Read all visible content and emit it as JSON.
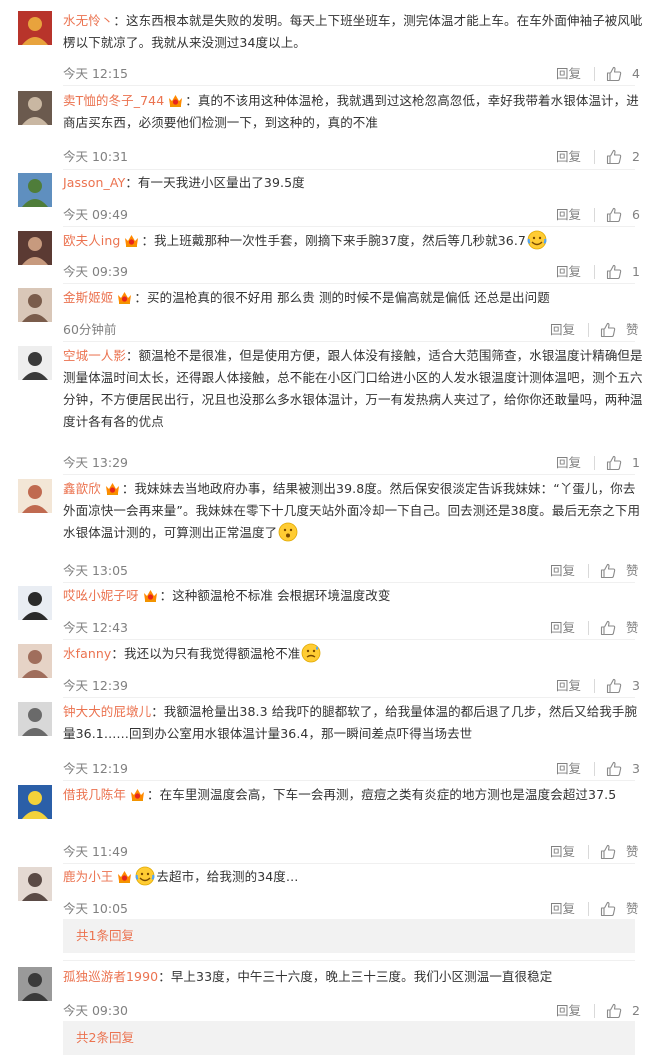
{
  "ui": {
    "reply_label": "回复",
    "like_label": "赞",
    "like_icon": "thumbs-up-icon",
    "badge_icon": "vip-crown-badge-icon"
  },
  "comments": [
    {
      "user": "水无怜丶",
      "text": "：这东西根本就是失败的发明。每天上下班坐班车，测完体温才能上车。在车外面伸袖子被风呲楞以下就凉了。我就从来没测过34度以上。",
      "time": "今天 12:15",
      "likes": "4"
    },
    {
      "user": "卖T恤的冬子_744",
      "text": "：真的不该用这种体温枪，我就遇到过这枪忽高忽低，幸好我带着水银体温计，进商店买东西，必须要他们检测一下，到这种的，真的不准",
      "time": "今天 10:31",
      "likes": "2"
    },
    {
      "user": "Jasson_AY",
      "text": "：有一天我进小区量出了39.5度",
      "time": "今天 09:49",
      "likes": "6"
    },
    {
      "user": "欧夫人ing",
      "text": "：我上班戴那种一次性手套，刚摘下来手腕37度，然后等几秒就36.7",
      "time": "今天 09:39",
      "likes": "1",
      "emoji": "laughing-tears-emoji"
    },
    {
      "user": "金斯姬姬",
      "text": "：买的温枪真的很不好用 那么贵 测的时候不是偏高就是偏低 还总是出问题",
      "time": "60分钟前",
      "likes": "赞"
    },
    {
      "user": "空城一人影",
      "text": "：额温枪不是很准，但是使用方便，跟人体没有接触，适合大范围筛查，水银温度计精确但是测量体温时间太长，还得跟人体接触，总不能在小区门口给进小区的人发水银温度计测体温吧，测个五六分钟，不方便居民出行，况且也没那么多水银体温计，万一有发热病人夹过了，给你你还敢量吗，两种温度计各有各的优点",
      "time": "今天 13:29",
      "likes": "1"
    },
    {
      "user": "鑫歆欣",
      "text": "：我妹妹去当地政府办事，结果被测出39.8度。然后保安很淡定告诉我妹妹：“丫蛋儿，你去外面凉快一会再来量”。我妹妹在零下十几度天站外面冷却一下自己。回去测还是38度。最后无奈之下用水银体温计测的，可算测出正常温度了",
      "time": "今天 13:05",
      "likes": "赞",
      "emoji": "surprised-face-emoji"
    },
    {
      "user": "哎吆小妮子呀",
      "text": "：这种额温枪不标准 会根据环境温度改变",
      "time": "今天 12:43",
      "likes": "赞"
    },
    {
      "user": "水fanny",
      "text": "：我还以为只有我觉得额温枪不准",
      "time": "今天 12:39",
      "likes": "3",
      "emoji": "sweat-face-emoji"
    },
    {
      "user": "钟大大的屁墩儿",
      "text": "：我额温枪量出38.3 给我吓的腿都软了，给我量体温的都后退了几步，然后又给我手腕量36.1……回到办公室用水银体温计量36.4，那一瞬间差点吓得当场去世",
      "time": "今天 12:19",
      "likes": "3"
    },
    {
      "user": "借我几陈年",
      "text": "：在车里测温度会高，下车一会再测，痘痘之类有炎症的地方测也是温度会超过37.5",
      "time": "今天 11:49",
      "likes": "赞"
    },
    {
      "user": "鹿为小王",
      "text": "去超市，给我测的34度…",
      "time": "今天 10:05",
      "likes": "赞",
      "emoji": "laughing-tears-emoji",
      "replies": "共1条回复"
    },
    {
      "user": "孤独巡游者1990",
      "text": "：早上33度，中午三十六度，晚上三十三度。我们小区测温一直很稳定",
      "time": "今天 09:30",
      "likes": "2",
      "replies": "共2条回复"
    }
  ],
  "colors": {
    "username": "#eb7350",
    "meta": "#808080",
    "text": "#333333",
    "subreply_bg": "#f2f2f2"
  }
}
